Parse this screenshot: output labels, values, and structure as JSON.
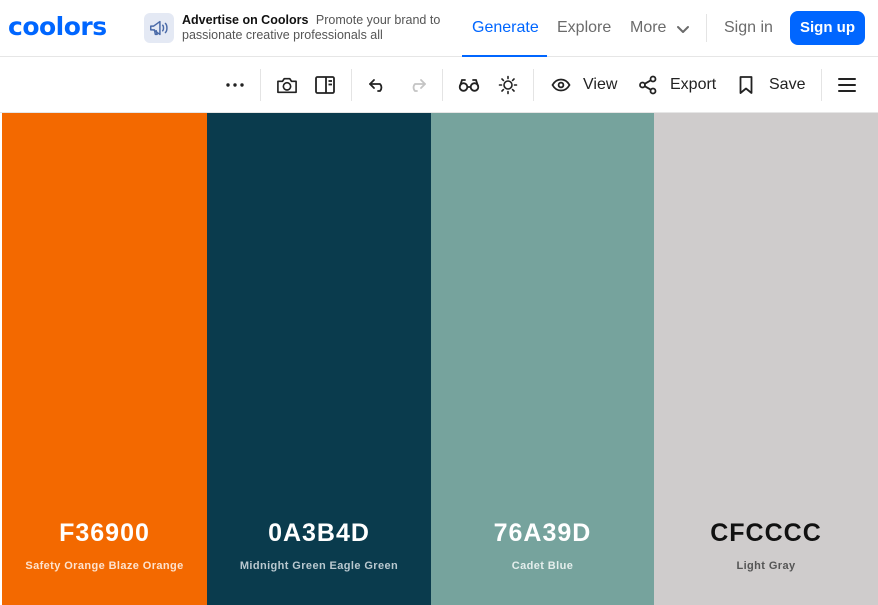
{
  "brand": {
    "logo": "coolors",
    "color": "#0066ff"
  },
  "ad": {
    "title": "Advertise on Coolors",
    "text": "Promote your brand to passionate creative professionals all",
    "icon": "megaphone-icon"
  },
  "nav": {
    "generate": "Generate",
    "explore": "Explore",
    "more": "More",
    "sign_in": "Sign in",
    "sign_up": "Sign up"
  },
  "toolbar": {
    "icons": [
      "more-icon",
      "camera-icon",
      "sidebar-icon",
      "undo-icon",
      "redo-icon",
      "glasses-icon",
      "sun-icon",
      "eye-icon",
      "share-icon",
      "bookmark-icon",
      "menu-icon"
    ],
    "view_label": "View",
    "export_label": "Export",
    "save_label": "Save"
  },
  "palette": {
    "colors": [
      {
        "hex": "F36900",
        "name": "Safety Orange Blaze Orange",
        "bg": "#F36900",
        "text": "#ffffff",
        "subtext": "#fde3cf"
      },
      {
        "hex": "0A3B4D",
        "name": "Midnight Green Eagle Green",
        "bg": "#0A3B4D",
        "text": "#ffffff",
        "subtext": "#b9c8cf"
      },
      {
        "hex": "76A39D",
        "name": "Cadet Blue",
        "bg": "#76A39D",
        "text": "#ffffff",
        "subtext": "#e4eeec"
      },
      {
        "hex": "CFCCCC",
        "name": "Light Gray",
        "bg": "#CFCCCC",
        "text": "#111111",
        "subtext": "#555555"
      }
    ]
  }
}
